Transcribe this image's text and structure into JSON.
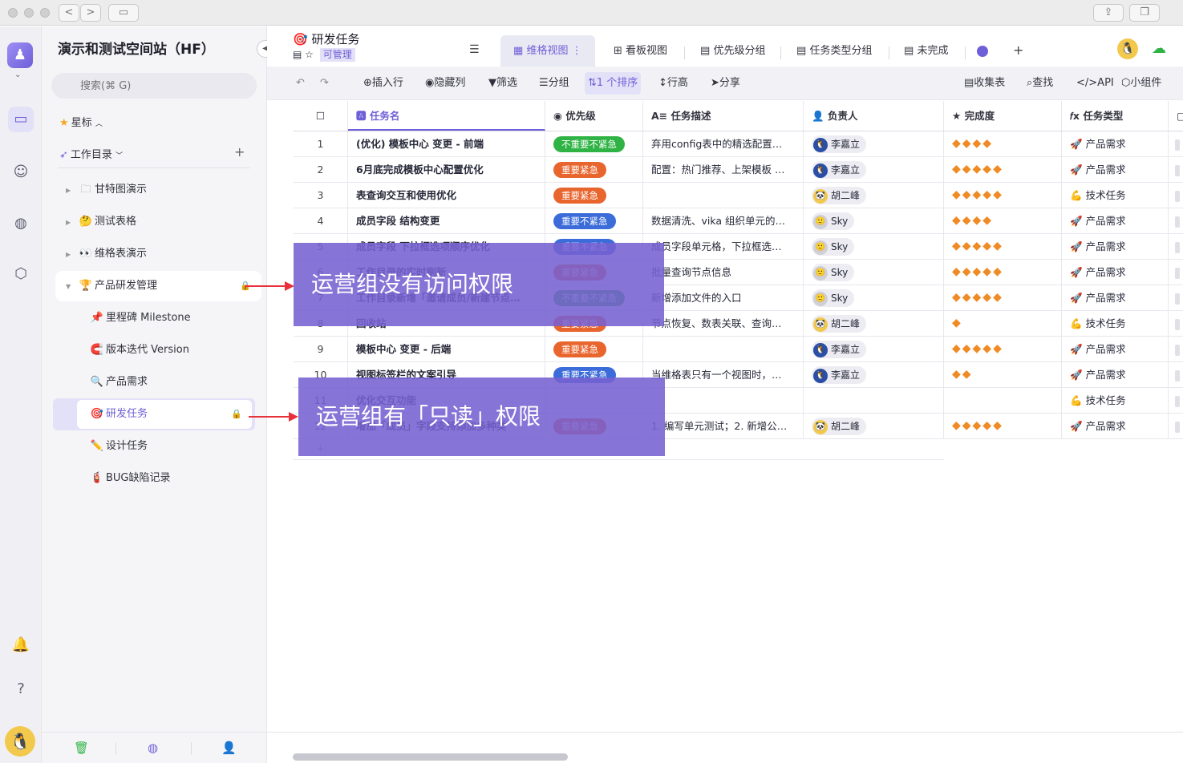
{
  "window": {
    "nav_back": "<",
    "nav_forward": ">"
  },
  "sidebar": {
    "space_name": "演示和测试空间站（HF）",
    "search_placeholder": "搜索(⌘ G)",
    "starred_label": "星标",
    "catalog_label": "工作目录",
    "add_label": "+",
    "items": [
      {
        "label": "甘特图演示",
        "icon": "folder-icon"
      },
      {
        "label": "测试表格",
        "icon": "thinking-face-icon"
      },
      {
        "label": "维格表演示",
        "icon": "eyes-icon"
      },
      {
        "label": "产品研发管理",
        "icon": "trophy-icon"
      },
      {
        "label": "里程碑 Milestone",
        "icon": "pin-icon"
      },
      {
        "label": "版本迭代 Version",
        "icon": "magnet-icon"
      },
      {
        "label": "产品需求",
        "icon": "magnifier-icon"
      },
      {
        "label": "研发任务",
        "icon": "target-icon"
      },
      {
        "label": "设计任务",
        "icon": "pencil-icon"
      },
      {
        "label": "BUG缺陷记录",
        "icon": "fire-extinguisher-icon"
      }
    ]
  },
  "header": {
    "title": "研发任务",
    "permission_badge": "可管理",
    "tabs": [
      "维格视图",
      "看板视图",
      "优先级分组",
      "任务类型分组",
      "未完成"
    ],
    "add_view": "+"
  },
  "toolbar": {
    "insert_row": "插入行",
    "hide_columns": "隐藏列",
    "filter": "筛选",
    "group": "分组",
    "sort": "1 个排序",
    "row_height": "行高",
    "share": "分享",
    "form": "收集表",
    "find": "查找",
    "api": "API",
    "widget": "小组件"
  },
  "table": {
    "columns": [
      "任务名",
      "优先级",
      "任务描述",
      "负责人",
      "完成度",
      "任务类型"
    ],
    "add_row": "+",
    "rows": [
      {
        "no": "1",
        "name": "(优化) 模板中心 变更 - 前端",
        "priority": "不重要不紧急",
        "desc": "弃用config表中的精选配置…",
        "owner": "李嘉立",
        "stars": 4,
        "type": "产品需求"
      },
      {
        "no": "2",
        "name": "6月底完成模板中心配置优化",
        "priority": "重要紧急",
        "desc": "配置：热门推荐、上架模板 …",
        "owner": "李嘉立",
        "stars": 5,
        "type": "产品需求"
      },
      {
        "no": "3",
        "name": "表查询交互和使用优化",
        "priority": "重要紧急",
        "desc": "",
        "owner": "胡二峰",
        "stars": 5,
        "type": "技术任务"
      },
      {
        "no": "4",
        "name": "成员字段 结构变更",
        "priority": "重要不紧急",
        "desc": "数据清洗、vika 组织单元的…",
        "owner": "Sky",
        "stars": 4,
        "type": "产品需求"
      },
      {
        "no": "5",
        "name": "成员字段 下拉框选项顺序优化",
        "priority": "重要不紧急",
        "desc": "成员字段单元格，下拉框选…",
        "owner": "Sky",
        "stars": 5,
        "type": "产品需求"
      },
      {
        "no": "6",
        "name": "工作目录的实时刷新",
        "priority": "重要紧急",
        "desc": "批量查询节点信息",
        "owner": "Sky",
        "stars": 5,
        "type": "产品需求"
      },
      {
        "no": "7",
        "name": "工作目录新增「邀请成员/新建节点…",
        "priority": "不重要不紧急",
        "desc": "新增添加文件的入口",
        "owner": "Sky",
        "stars": 5,
        "type": "产品需求"
      },
      {
        "no": "8",
        "name": "回收站",
        "priority": "重要紧急",
        "desc": "节点恢复、数表关联、查询…",
        "owner": "胡二峰",
        "stars": 1,
        "type": "技术任务"
      },
      {
        "no": "9",
        "name": "模板中心 变更 - 后端",
        "priority": "重要紧急",
        "desc": "",
        "owner": "李嘉立",
        "stars": 5,
        "type": "产品需求"
      },
      {
        "no": "10",
        "name": "视图标签栏的文案引导",
        "priority": "重要不紧急",
        "desc": "当维格表只有一个视图时，…",
        "owner": "李嘉立",
        "stars": 2,
        "type": "产品需求"
      },
      {
        "no": "11",
        "name": "优化交互功能",
        "priority": "",
        "desc": "",
        "owner": "",
        "stars": 0,
        "type": "技术任务"
      },
      {
        "no": "12",
        "name": "增加「成员」字段支持添加多种类",
        "priority": "重要紧急",
        "desc": "1. 编写单元测试；2. 新增公…",
        "owner": "胡二峰",
        "stars": 5,
        "type": "产品需求"
      }
    ]
  },
  "annotations": {
    "no_access": "运营组没有访问权限",
    "read_only": "运营组有「只读」权限"
  },
  "colors": {
    "accent": "#6e5fd8",
    "priority_green": "#2fb345",
    "priority_orange": "#e8652e",
    "priority_blue": "#3b6cd9",
    "overlay": "#7661d2",
    "arrow": "#e8313b"
  }
}
